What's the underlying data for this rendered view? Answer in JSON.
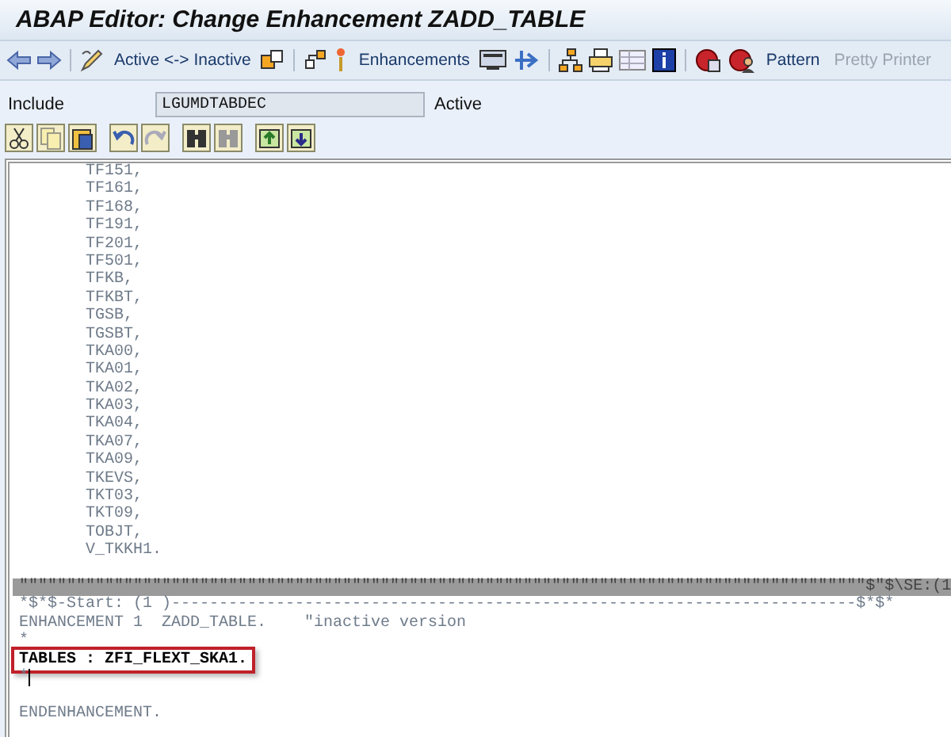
{
  "window": {
    "title": "ABAP Editor: Change Enhancement ZADD_TABLE"
  },
  "toolbar": {
    "buttons": [
      {
        "label": "Active <-> Inactive",
        "disabled": false
      },
      {
        "label": "Enhancements",
        "disabled": false
      },
      {
        "label": "Pattern",
        "disabled": false
      },
      {
        "label": "Pretty Printer",
        "disabled": true
      }
    ]
  },
  "include": {
    "label": "Include",
    "value": "LGUMDTABDEC",
    "status": "Active"
  },
  "editor": {
    "lines": [
      {
        "kind": "code",
        "text": "       TF151,"
      },
      {
        "kind": "code",
        "text": "       TF161,"
      },
      {
        "kind": "code",
        "text": "       TF168,"
      },
      {
        "kind": "code",
        "text": "       TF191,"
      },
      {
        "kind": "code",
        "text": "       TF201,"
      },
      {
        "kind": "code",
        "text": "       TF501,"
      },
      {
        "kind": "code",
        "text": "       TFKB,"
      },
      {
        "kind": "code",
        "text": "       TFKBT,"
      },
      {
        "kind": "code",
        "text": "       TGSB,"
      },
      {
        "kind": "code",
        "text": "       TGSBT,"
      },
      {
        "kind": "code",
        "text": "       TKA00,"
      },
      {
        "kind": "code",
        "text": "       TKA01,"
      },
      {
        "kind": "code",
        "text": "       TKA02,"
      },
      {
        "kind": "code",
        "text": "       TKA03,"
      },
      {
        "kind": "code",
        "text": "       TKA04,"
      },
      {
        "kind": "code",
        "text": "       TKA07,"
      },
      {
        "kind": "code",
        "text": "       TKA09,"
      },
      {
        "kind": "code",
        "text": "       TKEVS,"
      },
      {
        "kind": "code",
        "text": "       TKT03,"
      },
      {
        "kind": "code",
        "text": "       TKT09,"
      },
      {
        "kind": "code",
        "text": "       TOBJT,"
      },
      {
        "kind": "code",
        "text": "       V_TKKH1."
      },
      {
        "kind": "blank"
      },
      {
        "kind": "divider",
        "text": "\"\"\"\"\"\"\"\"\"\"\"\"\"\"\"\"\"\"\"\"\"\"\"\"\"\"\"\"\"\"\"\"\"\"\"\"\"\"\"\"\"\"\"\"\"\"\"\"\"\"\"\"\"\"\"\"\"\"\"\"\"\"\"\"\"\"\"\"\"\"\"\"\"\"\"\"\"\"\"\"\"\"\"\"\"\"\"\"\"$\"$\\SE:(1"
      },
      {
        "kind": "code",
        "text": "*$*$-Start: (1 )------------------------------------------------------------------------$*$*"
      },
      {
        "kind": "code",
        "text": "ENHANCEMENT 1  ZADD_TABLE.    \"inactive version"
      },
      {
        "kind": "code",
        "text": "*"
      },
      {
        "kind": "highlight",
        "text": "TABLES : ZFI_FLEXT_SKA1."
      },
      {
        "kind": "cursor",
        "text": "*"
      },
      {
        "kind": "blank"
      },
      {
        "kind": "code",
        "text": "ENDENHANCEMENT."
      }
    ]
  }
}
